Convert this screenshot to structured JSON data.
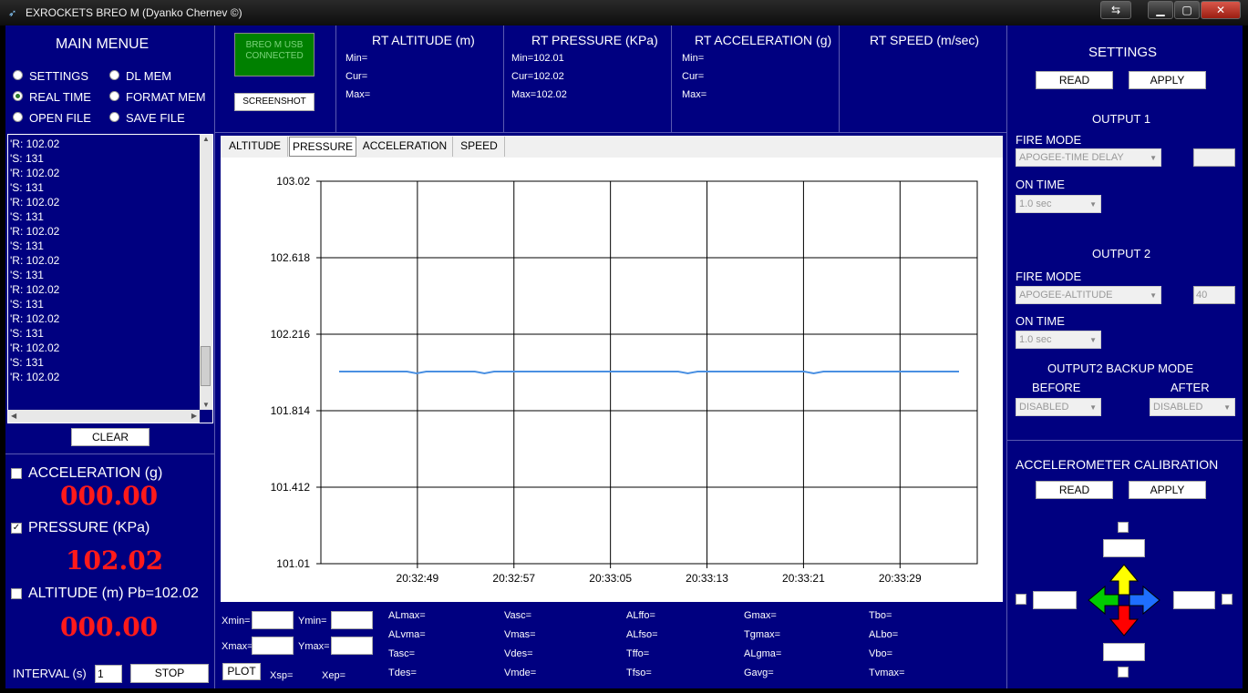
{
  "window": {
    "title": "EXROCKETS BREO M   (Dyanko Chernev ©)"
  },
  "menu": {
    "title": "MAIN MENUE",
    "items": [
      "SETTINGS",
      "DL MEM",
      "REAL TIME",
      "FORMAT MEM",
      "OPEN FILE",
      "SAVE FILE"
    ],
    "selected": "REAL TIME"
  },
  "log": {
    "lines": [
      "'R: 102.02",
      "'S: 131",
      "'R: 102.02",
      "'S: 131",
      "'R: 102.02",
      "'S: 131",
      "'R: 102.02",
      "'S: 131",
      "'R: 102.02",
      "'S: 131",
      "'R: 102.02",
      "'S: 131",
      "'R: 102.02",
      "'S: 131",
      "'R: 102.02",
      "'S: 131",
      "'R: 102.02"
    ]
  },
  "clear_label": "CLEAR",
  "readouts": {
    "accel_label": "ACCELERATION (g)",
    "accel_value": "000.00",
    "accel_checked": false,
    "pressure_label": "PRESSURE (KPa)",
    "pressure_value": "102.02",
    "pressure_checked": true,
    "altitude_label": "ALTITUDE (m) Pb=102.02",
    "altitude_value": "000.00",
    "altitude_checked": false,
    "interval_label": "INTERVAL (s)",
    "interval_value": "1",
    "stop_label": "STOP"
  },
  "status": {
    "text": "BREO M USB CONNECTED",
    "color": "#008000",
    "screenshot_label": "SCREENSHOT"
  },
  "rt": {
    "altitude": {
      "title": "RT ALTITUDE (m)",
      "min": "Min=",
      "cur": "Cur=",
      "max": "Max="
    },
    "pressure": {
      "title": "RT PRESSURE (KPa)",
      "min": "Min=102.01",
      "cur": "Cur=102.02",
      "max": "Max=102.02"
    },
    "acceleration": {
      "title": "RT ACCELERATION (g)",
      "min": "Min=",
      "cur": "Cur=",
      "max": "Max="
    },
    "speed": {
      "title": "RT SPEED (m/sec)"
    }
  },
  "tabs": [
    "ALTITUDE",
    "PRESSURE",
    "ACCELERATION",
    "SPEED"
  ],
  "active_tab": "PRESSURE",
  "chart_data": {
    "type": "line",
    "title": "",
    "xlabel": "",
    "ylabel": "",
    "ylim": [
      101.01,
      103.02
    ],
    "yticks": [
      "103.02",
      "102.618",
      "102.216",
      "101.814",
      "101.412",
      "101.01"
    ],
    "xticks": [
      "20:32:49",
      "20:32:57",
      "20:33:05",
      "20:33:13",
      "20:33:21",
      "20:33:29"
    ],
    "grid": true,
    "line_color": "#4a90e2",
    "series": [
      {
        "values": [
          102.02,
          102.02,
          102.02,
          102.02,
          102.02,
          102.02,
          102.02,
          102.02,
          102.01,
          102.02,
          102.02,
          102.02,
          102.02,
          102.02,
          102.02,
          102.01,
          102.02,
          102.02,
          102.02,
          102.02,
          102.02,
          102.02,
          102.02,
          102.02,
          102.02,
          102.02,
          102.02,
          102.02,
          102.02,
          102.02,
          102.02,
          102.02,
          102.02,
          102.02,
          102.02,
          102.02,
          102.01,
          102.02,
          102.02,
          102.02,
          102.02,
          102.02,
          102.02,
          102.02,
          102.02,
          102.02,
          102.02,
          102.02,
          102.02,
          102.01,
          102.02,
          102.02,
          102.02,
          102.02,
          102.02,
          102.02,
          102.02,
          102.02,
          102.02,
          102.02,
          102.02,
          102.02,
          102.02,
          102.02,
          102.02
        ]
      }
    ]
  },
  "plot_controls": {
    "xmin": "Xmin=",
    "ymin": "Ymin=",
    "xmax": "Xmax=",
    "ymax": "Ymax=",
    "plot": "PLOT",
    "xsp": "Xsp=",
    "xep": "Xep="
  },
  "stats": [
    [
      "ALmax=",
      "ALvma=",
      "Tasc=",
      "Tdes="
    ],
    [
      "Vasc=",
      "Vmas=",
      "Vdes=",
      "Vmde="
    ],
    [
      "ALffo=",
      "ALfso=",
      "Tffo=",
      "Tfso="
    ],
    [
      "Gmax=",
      "Tgmax=",
      "ALgma=",
      "Gavg="
    ],
    [
      "Tbo=",
      "ALbo=",
      "Vbo=",
      "Tvmax="
    ]
  ],
  "settings": {
    "title": "SETTINGS",
    "read": "READ",
    "apply": "APPLY",
    "output1": {
      "title": "OUTPUT 1",
      "fire_mode_label": "FIRE MODE",
      "fire_mode": "APOGEE-TIME DELAY",
      "extra": "",
      "on_time_label": "ON TIME",
      "on_time": "1.0 sec"
    },
    "output2": {
      "title": "OUTPUT 2",
      "fire_mode_label": "FIRE MODE",
      "fire_mode": "APOGEE-ALTITUDE",
      "extra": "40",
      "on_time_label": "ON TIME",
      "on_time": "1.0 sec"
    },
    "backup": {
      "title": "OUTPUT2 BACKUP MODE",
      "before_label": "BEFORE",
      "after_label": "AFTER",
      "before": "DISABLED",
      "after": "DISABLED"
    }
  },
  "calibration": {
    "title": "ACCELEROMETER CALIBRATION",
    "read": "READ",
    "apply": "APPLY"
  }
}
